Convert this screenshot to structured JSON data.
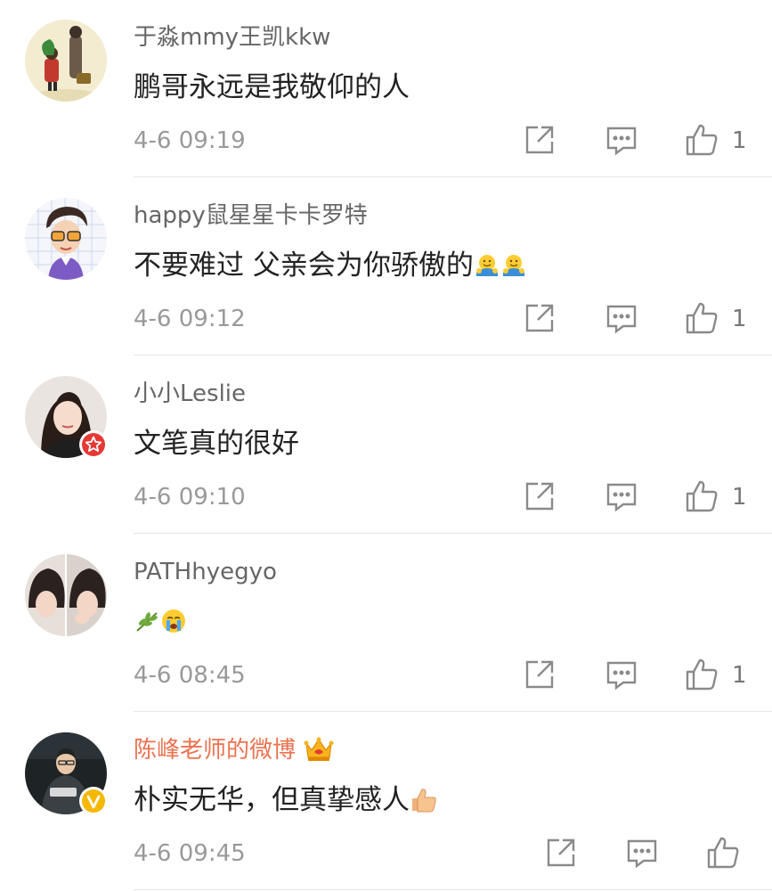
{
  "comments": [
    {
      "username": "于淼mmy王凯kkw",
      "text": "鹏哥永远是我敬仰的人",
      "time": "4-6 09:19",
      "likes": "1"
    },
    {
      "username": "happy鼠星星卡卡罗特",
      "text": "不要难过  父亲会为你骄傲的",
      "emojis": [
        "hug-emoji",
        "hug-emoji"
      ],
      "time": "4-6 09:12",
      "likes": "1"
    },
    {
      "username": "小小Leslie",
      "text": "文笔真的很好",
      "badge": "star-badge-red",
      "time": "4-6 09:10",
      "likes": "1"
    },
    {
      "username": "PATHhyegyo",
      "text": "",
      "emojis": [
        "olive-branch-emoji",
        "crying-emoji"
      ],
      "time": "4-6 08:45",
      "likes": "1"
    },
    {
      "username": "陈峰老师的微博",
      "text": "朴实无华，但真挚感人",
      "emojis": [
        "thumbs-up-emoji"
      ],
      "badge": "verified-badge-yellow",
      "vip_icon": "crown-icon",
      "time": "4-6 09:45",
      "likes": ""
    }
  ],
  "icons": {
    "share": "share-icon",
    "reply": "comment-icon",
    "like": "thumbs-up-icon"
  },
  "colors": {
    "vip_name": "#eb7350",
    "verified_badge": "#f5b800",
    "star_badge": "#e53935",
    "meta_text": "#999999"
  }
}
